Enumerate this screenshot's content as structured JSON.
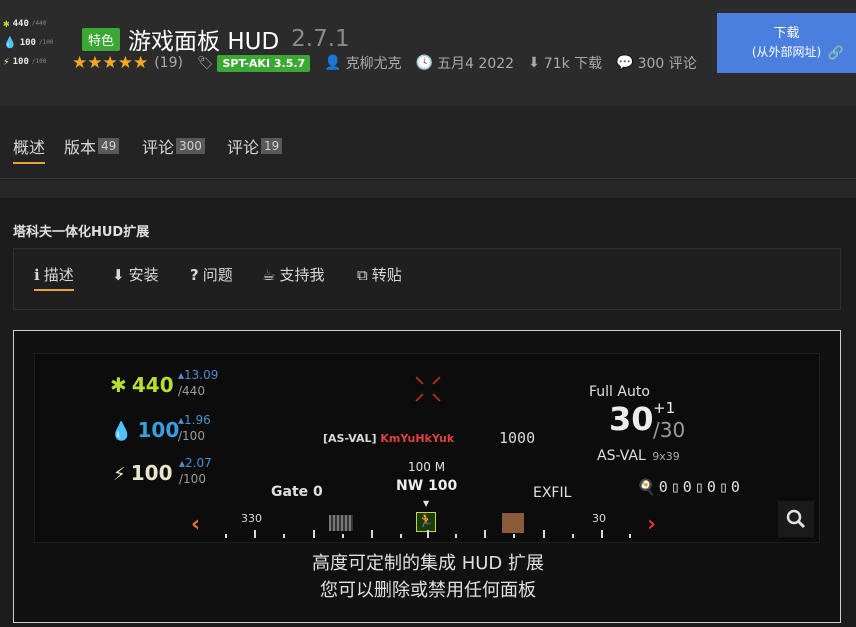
{
  "header": {
    "logo": {
      "health": "440",
      "health_max": "/440",
      "hydration": "100",
      "hydration_max": "/100",
      "energy": "100",
      "energy_max": "/100"
    },
    "featured_label": "特色",
    "title": "游戏面板 HUD",
    "version": "2.7.1",
    "rating_count": "(19)",
    "tag": "SPT-AKI 3.5.7",
    "author": "克柳尤克",
    "date": "五月4 2022",
    "downloads": "71k 下载",
    "comments": "300 评论",
    "download_button": {
      "label": "下载",
      "sub": "(从外部网址)"
    }
  },
  "tabs": [
    {
      "label": "概述",
      "count": ""
    },
    {
      "label": "版本",
      "count": "49"
    },
    {
      "label": "评论",
      "count": "300"
    },
    {
      "label": "评论",
      "count": "19"
    }
  ],
  "section": {
    "title": "塔科夫一体化HUD扩展",
    "subtabs": [
      {
        "label": "描述",
        "icon": "info-icon"
      },
      {
        "label": "安装",
        "icon": "download-icon"
      },
      {
        "label": "问题",
        "icon": "question-icon"
      },
      {
        "label": "支持我",
        "icon": "coffee-icon"
      },
      {
        "label": "转贴",
        "icon": "copy-icon"
      }
    ]
  },
  "hud": {
    "health": {
      "value": "440",
      "delta": "▴13.09",
      "max": "/440"
    },
    "hydration": {
      "value": "100",
      "delta": "▴1.96",
      "max": "/100"
    },
    "energy": {
      "value": "100",
      "delta": "▴2.07",
      "max": "/100"
    },
    "kill_weapon": "[AS-VAL]",
    "kill_name": "KmYuHkYuk",
    "kill_distance": "1000",
    "fire_mode": "Full Auto",
    "ammo": "30",
    "ammo_plus": "+1",
    "ammo_max": "/30",
    "weapon_name": "AS-VAL",
    "caliber": "9x39",
    "grenades": [
      "0",
      "0",
      "0",
      "0"
    ],
    "distance": "100 M",
    "heading": "NW 100",
    "gate_label": "Gate 0",
    "exfil_label": "EXFIL",
    "compass_left": "330",
    "compass_right": "30"
  },
  "caption": {
    "line1": "高度可定制的集成 HUD 扩展",
    "line2": "您可以删除或禁用任何面板"
  },
  "colors": {
    "health": "#b6e02d",
    "hydration": "#3a9de0",
    "energy": "#e8e8c8",
    "accent": "#e8a33b",
    "featured": "#3aa832",
    "download_button": "#4a7fe0",
    "kill_name": "#e04040"
  }
}
